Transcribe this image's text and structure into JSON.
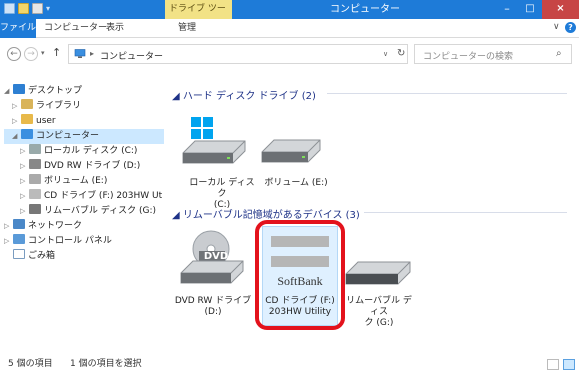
{
  "window": {
    "context_tab": "ドライブ ツール",
    "title": "コンピューター",
    "min_glyph": "–",
    "max_glyph": "□",
    "close_glyph": "×",
    "accent": "#1e7bd8"
  },
  "ribbon": {
    "tabs": [
      "ファイル",
      "コンピューター",
      "表示",
      "管理"
    ],
    "help_glyph": "?",
    "collapse_glyph": "∨"
  },
  "nav": {
    "back_glyph": "←",
    "forward_glyph": "→",
    "up_glyph": "↑",
    "crumb_sep": "▸",
    "crumb": "コンピューター",
    "refresh_glyph": "↻",
    "search_placeholder": "コンピューターの検索",
    "search_glyph": "⌕"
  },
  "tree": {
    "desktop": "デスクトップ",
    "libraries": "ライブラリ",
    "user": "user",
    "computer": "コンピューター",
    "local_disk": "ローカル ディスク (C:)",
    "dvd": "DVD RW ドライブ (D:)",
    "volume_e": "ボリューム (E:)",
    "cd_drive": "CD ドライブ (F:) 203HW Ut",
    "removable_g": "リムーバブル ディスク (G:)",
    "network": "ネットワーク",
    "control_panel": "コントロール パネル",
    "recycle_bin": "ごみ箱"
  },
  "content": {
    "hdd_group": "ハード ディスク ドライブ (2)",
    "removable_group": "リムーバブル記憶域があるデバイス (3)",
    "drive_c": [
      "ローカル ディスク",
      "(C:)"
    ],
    "drive_e": [
      "ボリューム (E:)"
    ],
    "drive_d": [
      "DVD RW ドライブ",
      "(D:)"
    ],
    "drive_f": [
      "CD ドライブ (F:)",
      "203HW Utility"
    ],
    "drive_g": [
      "リムーバブル ディス",
      "ク (G:)"
    ],
    "dvd_logo": "DVD",
    "brand": "SoftBank"
  },
  "status": {
    "items": "5 個の項目",
    "selected": "1 個の項目を選択"
  }
}
